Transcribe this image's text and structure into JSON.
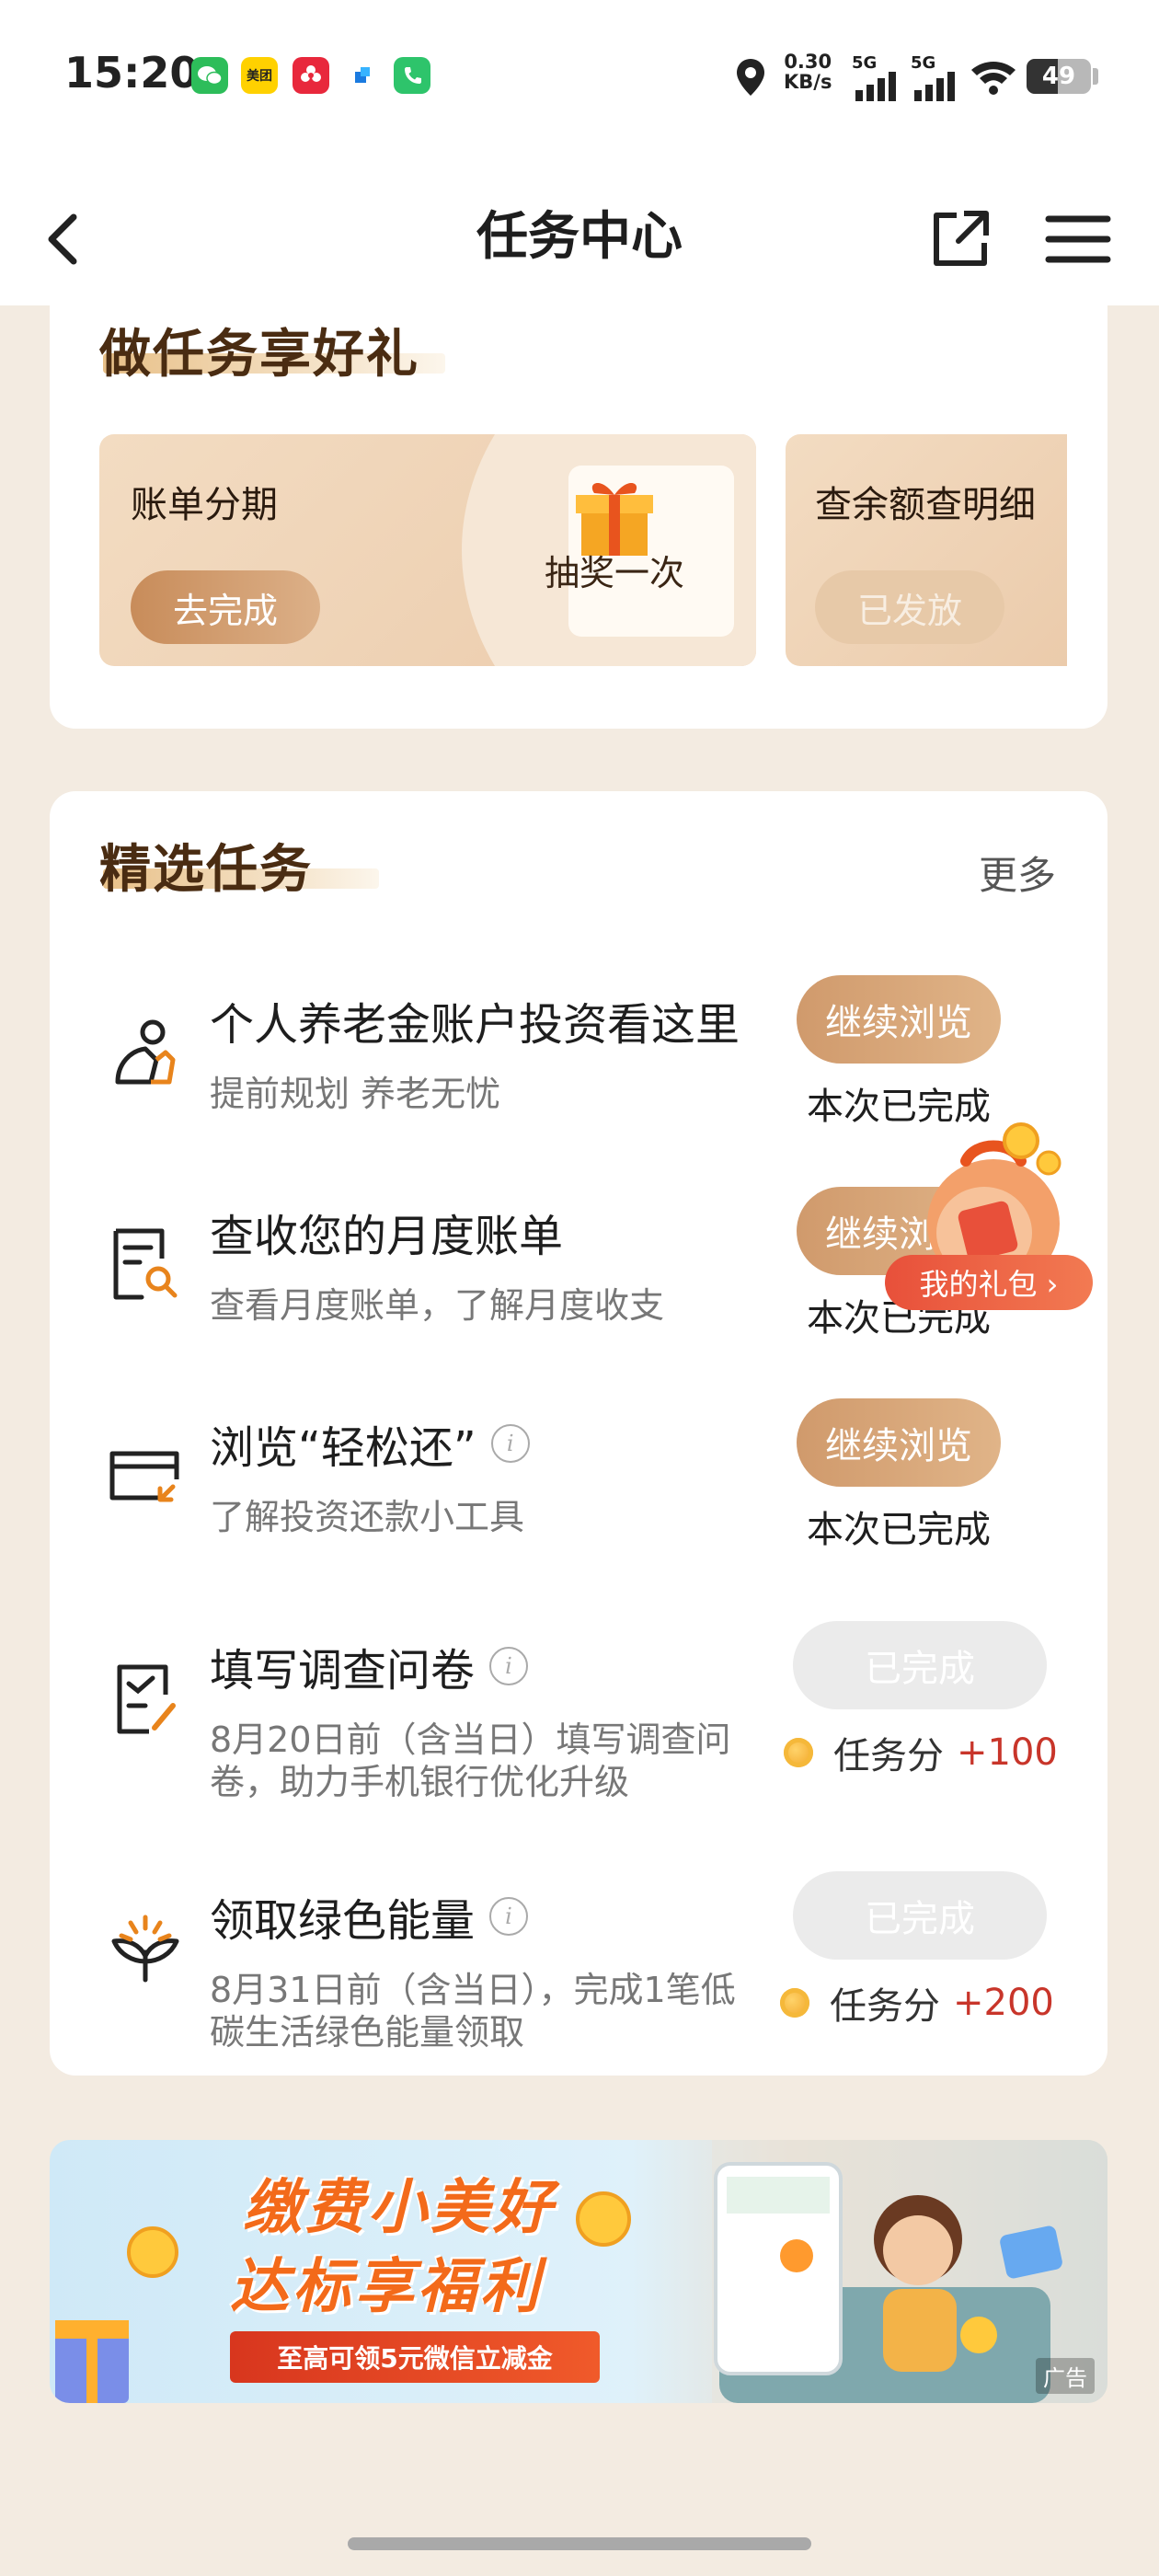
{
  "status_bar": {
    "time": "15:20",
    "net_speed_value": "0.30",
    "net_speed_unit": "KB/s",
    "signal_1": "5G",
    "signal_2": "5G",
    "battery": "49",
    "battery_level": 0.49,
    "app_icons": [
      "wechat-icon",
      "meituan-icon",
      "flower-app-icon",
      "blue-app-icon",
      "phone-app-icon"
    ],
    "meituan_label": "美团"
  },
  "nav": {
    "title": "任务中心",
    "back_icon": "chevron-left-icon",
    "share_icon": "share-icon",
    "menu_icon": "menu-icon"
  },
  "promo_section": {
    "title": "做任务享好礼",
    "tiles": [
      {
        "label": "账单分期",
        "button": "去完成",
        "reward": "抽奖一次",
        "state": "active"
      },
      {
        "label": "查余额查明细",
        "button": "已发放",
        "state": "done"
      }
    ]
  },
  "featured": {
    "title": "精选任务",
    "more": "更多",
    "tasks": [
      {
        "icon": "pension-person-icon",
        "title": "个人养老金账户投资看这里",
        "desc": "提前规划 养老无忧",
        "button": "继续浏览",
        "status": "本次已完成"
      },
      {
        "icon": "bill-search-icon",
        "title": "查收您的月度账单",
        "desc": "查看月度账单，了解月度收支",
        "button": "继续浏览",
        "status": "本次已完成"
      },
      {
        "icon": "repay-tool-icon",
        "title": "浏览“轻松还”",
        "desc": "了解投资还款小工具",
        "button": "继续浏览",
        "status": "本次已完成",
        "has_info": true
      },
      {
        "icon": "survey-edit-icon",
        "title": "填写调查问卷",
        "desc": "8月20日前（含当日）填写调查问卷，助力手机银行优化升级",
        "button": "已完成",
        "points_label": "任务分",
        "points_value": "+100",
        "has_info": true
      },
      {
        "icon": "green-sprout-icon",
        "title": "领取绿色能量",
        "desc": "8月31日前（含当日），完成1笔低碳生活绿色能量领取",
        "button": "已完成",
        "points_label": "任务分",
        "points_value": "+200",
        "has_info": true
      }
    ]
  },
  "gift_float": {
    "label": "我的礼包 ›"
  },
  "banner": {
    "line1": "缴费小美好",
    "line2": "达标享福利",
    "ribbon": "至高可领5元微信立减金",
    "ad": "广告"
  },
  "colors": {
    "accent": "#d09a6c",
    "page_bg": "#f3ebe1",
    "points_red": "#c8352a",
    "title_brown": "#4a2c12"
  }
}
